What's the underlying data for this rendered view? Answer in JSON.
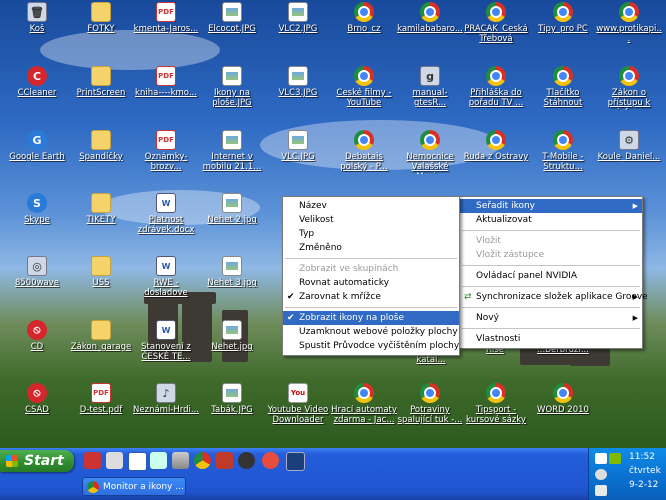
{
  "desktop": {
    "icons": [
      {
        "label": "Koš",
        "glyph": "misc",
        "sym": "🗑"
      },
      {
        "label": "FOTKY",
        "glyph": "folder",
        "sym": ""
      },
      {
        "label": "kmenta-Jaros...",
        "glyph": "pdf",
        "sym": "PDF"
      },
      {
        "label": "Elcocot.JPG",
        "glyph": "img",
        "sym": ""
      },
      {
        "label": "VLC2.JPG",
        "glyph": "img",
        "sym": ""
      },
      {
        "label": "Brno_cz",
        "glyph": "chrome",
        "sym": ""
      },
      {
        "label": "kamilababaro...",
        "glyph": "chrome",
        "sym": ""
      },
      {
        "label": "PRAČAK_Česká Třebová",
        "glyph": "chrome",
        "sym": ""
      },
      {
        "label": "Tipy_pro PC",
        "glyph": "chrome",
        "sym": ""
      },
      {
        "label": "www.protikapi...",
        "glyph": "chrome",
        "sym": ""
      },
      {
        "label": "CCleaner",
        "glyph": "red",
        "sym": "C"
      },
      {
        "label": "PrintScreen",
        "glyph": "folder",
        "sym": ""
      },
      {
        "label": "kniha----kmo...",
        "glyph": "pdf",
        "sym": "PDF"
      },
      {
        "label": "Ikony na ploše.JPG",
        "glyph": "img",
        "sym": ""
      },
      {
        "label": "VLC3.JPG",
        "glyph": "img",
        "sym": ""
      },
      {
        "label": "České filmy - YouTube",
        "glyph": "chrome",
        "sym": ""
      },
      {
        "label": "manual-gtesR...",
        "glyph": "misc",
        "sym": "g"
      },
      {
        "label": "Přihláška do pořadu TV ...",
        "glyph": "chrome",
        "sym": ""
      },
      {
        "label": "Tlačítko Stáhnout",
        "glyph": "chrome",
        "sym": ""
      },
      {
        "label": "Zákon o přístupu k info...",
        "glyph": "chrome",
        "sym": ""
      },
      {
        "label": "Google Earth",
        "glyph": "blue",
        "sym": "G"
      },
      {
        "label": "Spandíčky",
        "glyph": "folder",
        "sym": ""
      },
      {
        "label": "Oznámky-brozv...",
        "glyph": "pdf",
        "sym": "PDF"
      },
      {
        "label": "Internet v mobilu 21.1...",
        "glyph": "img",
        "sym": ""
      },
      {
        "label": "VLC.JPG",
        "glyph": "img",
        "sym": ""
      },
      {
        "label": "Debatais polský - P...",
        "glyph": "chrome",
        "sym": ""
      },
      {
        "label": "Nemocnice Valašské Mezi...",
        "glyph": "chrome",
        "sym": ""
      },
      {
        "label": "Ruda z Ostravy",
        "glyph": "chrome",
        "sym": ""
      },
      {
        "label": "T-Mobile - Struktu...",
        "glyph": "chrome",
        "sym": ""
      },
      {
        "label": "Koule_Daniel...",
        "glyph": "misc",
        "sym": "⚙"
      },
      {
        "label": "Skype",
        "glyph": "blue",
        "sym": "S"
      },
      {
        "label": "TIKETY",
        "glyph": "folder",
        "sym": ""
      },
      {
        "label": "Platnost zdrávek.docx",
        "glyph": "doc",
        "sym": "W"
      },
      {
        "label": "Nehet 2.jpg",
        "glyph": "img",
        "sym": ""
      },
      {
        "label": "8500wave",
        "glyph": "misc",
        "sym": "◎"
      },
      {
        "label": "USS",
        "glyph": "folder",
        "sym": ""
      },
      {
        "label": "RWE - dosladove",
        "glyph": "doc",
        "sym": "W"
      },
      {
        "label": "Nehet 3.jpg",
        "glyph": "img",
        "sym": ""
      },
      {
        "label": "CD",
        "glyph": "red",
        "sym": "⦸"
      },
      {
        "label": "Zákon_garage",
        "glyph": "folder",
        "sym": ""
      },
      {
        "label": "Stanovení z ČESKÉ TE...",
        "glyph": "doc",
        "sym": "W"
      },
      {
        "label": "Nehet.jpg",
        "glyph": "img",
        "sym": ""
      },
      {
        "label": "ČSAD",
        "glyph": "red",
        "sym": "⦸"
      },
      {
        "label": "D-test.pdf",
        "glyph": "pdf",
        "sym": "PDF"
      },
      {
        "label": "Neznámí-Hrdi...",
        "glyph": "misc",
        "sym": "♪"
      },
      {
        "label": "Tabák.JPG",
        "glyph": "img",
        "sym": ""
      },
      {
        "label": "Youtube Video Downloader",
        "glyph": "yt",
        "sym": "You"
      },
      {
        "label": "Hrací automaty zdarma - Jac...",
        "glyph": "chrome",
        "sym": ""
      },
      {
        "label": "Potraviny spalující tuk -...",
        "glyph": "chrome",
        "sym": ""
      },
      {
        "label": "Tipsport - kursové sázky",
        "glyph": "chrome",
        "sym": ""
      },
      {
        "label": "WORD 2010",
        "glyph": "chrome",
        "sym": ""
      }
    ],
    "partial_labels": [
      "player",
      "zdarma",
      "virtuální katal...",
      "Rise",
      "...Berbruži..."
    ]
  },
  "context_menu": {
    "items": [
      {
        "label": "Seřadit ikony",
        "submenu": true,
        "highlight": true
      },
      {
        "label": "Aktualizovat"
      },
      {
        "sep": true
      },
      {
        "label": "Vložit",
        "disabled": true
      },
      {
        "label": "Vložit zástupce",
        "disabled": true
      },
      {
        "sep": true
      },
      {
        "label": "Ovládací panel NVIDIA"
      },
      {
        "sep": true
      },
      {
        "label": "Synchronizace složek aplikace Groove",
        "submenu": true,
        "icon": true
      },
      {
        "sep": true
      },
      {
        "label": "Nový",
        "submenu": true
      },
      {
        "sep": true
      },
      {
        "label": "Vlastnosti"
      }
    ]
  },
  "submenu": {
    "items": [
      {
        "label": "Název"
      },
      {
        "label": "Velikost"
      },
      {
        "label": "Typ"
      },
      {
        "label": "Změněno"
      },
      {
        "sep": true
      },
      {
        "label": "Zobrazit ve skupinách",
        "disabled": true
      },
      {
        "label": "Rovnat automaticky"
      },
      {
        "label": "Zarovnat k mřížce",
        "checked": true
      },
      {
        "sep": true
      },
      {
        "label": "Zobrazit ikony na ploše",
        "checked": true,
        "highlight": true
      },
      {
        "label": "Uzamknout webové položky plochy"
      },
      {
        "label": "Spustit Průvodce vyčištěním plochy"
      }
    ]
  },
  "taskbar": {
    "start_label": "Start",
    "task_button": "Monitor a ikony ...",
    "time": "11:52",
    "day": "čtvrtek",
    "date": "9-2-12"
  },
  "colors": {
    "highlight": "#316ac5",
    "taskbar": "#245edb",
    "start": "#2e8b2e"
  }
}
